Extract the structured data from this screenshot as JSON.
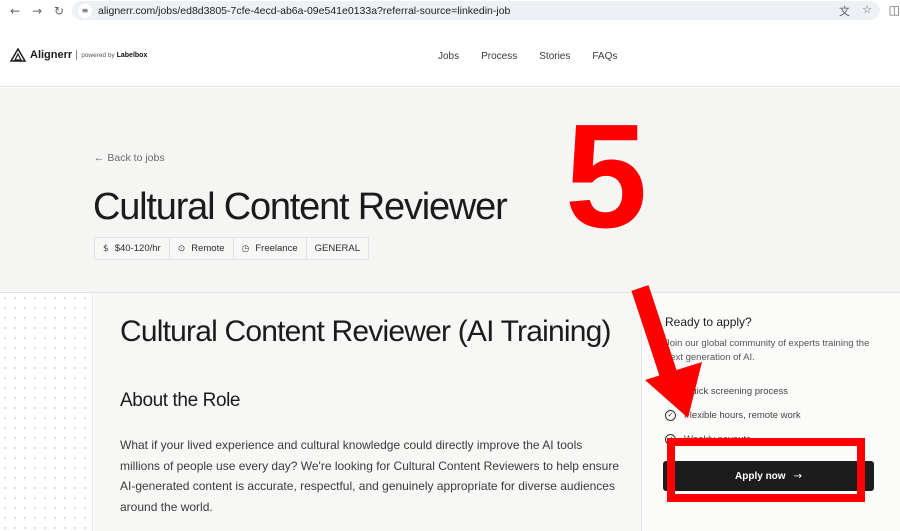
{
  "browser": {
    "url": "alignerr.com/jobs/ed8d3805-7cfe-4ecd-ab6a-09e541e0133a?referral-source=linkedin-job"
  },
  "header": {
    "brand_name": "Alignerr",
    "powered_by": "powered by",
    "powered_brand": "Labelbox",
    "nav": [
      "Jobs",
      "Process",
      "Stories",
      "FAQs"
    ]
  },
  "hero": {
    "back_link": "← Back to jobs",
    "title": "Cultural Content Reviewer",
    "tags": [
      {
        "icon": "dollar-icon",
        "label": "$40-120/hr"
      },
      {
        "icon": "location-pin-icon",
        "label": "Remote"
      },
      {
        "icon": "clock-icon",
        "label": "Freelance"
      },
      {
        "icon": "",
        "label": "GENERAL"
      }
    ]
  },
  "content": {
    "title": "Cultural Content Reviewer (AI Training)",
    "section_heading": "About the Role",
    "paragraph": "What if your lived experience and cultural knowledge could directly improve the AI tools millions of people use every day? We're looking for Cultural Content Reviewers to help ensure AI-generated content is accurate, respectful, and genuinely appropriate for diverse audiences around the world."
  },
  "sidebar": {
    "title": "Ready to apply?",
    "description": "Join our global community of experts training the next generation of AI.",
    "benefits": [
      "Quick screening process",
      "Flexible hours, remote work",
      "Weekly payouts"
    ],
    "apply_label": "Apply now"
  },
  "annotation": {
    "step_number": "5",
    "color": "#ff0000"
  }
}
